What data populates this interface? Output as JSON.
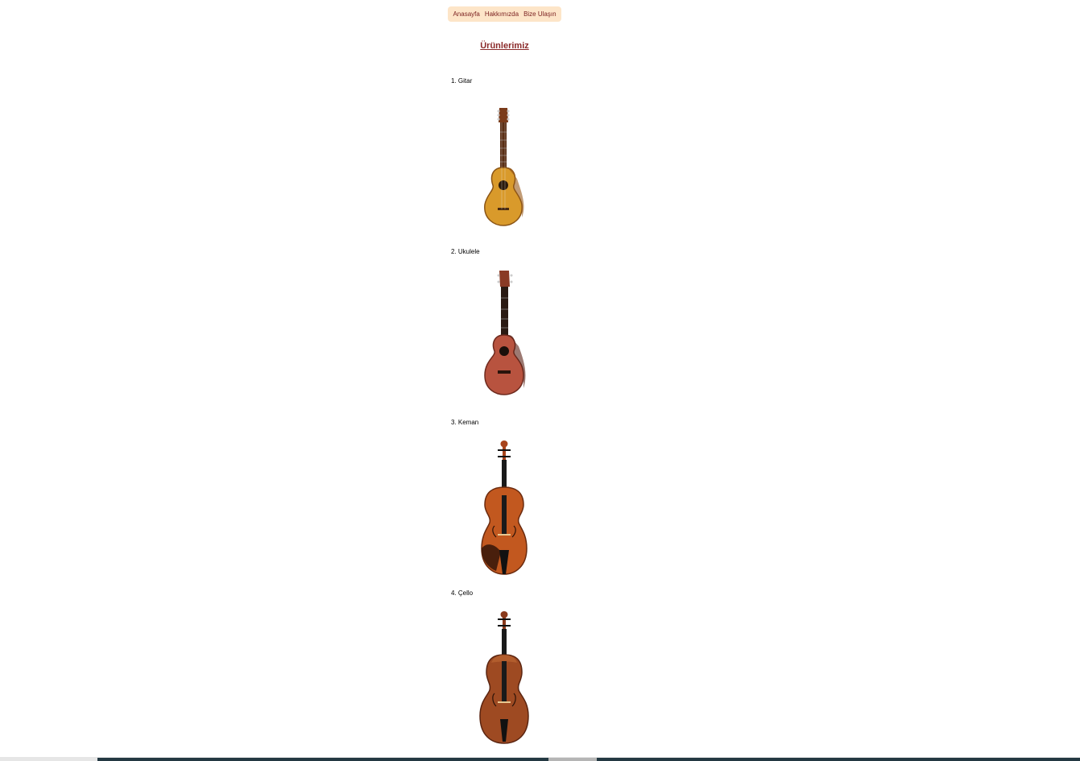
{
  "nav": {
    "home": "Anasayfa",
    "about": "Hakkımızda",
    "contact": "Bize Ulaşın"
  },
  "page": {
    "title": "Ürünlerimiz"
  },
  "products": [
    {
      "label": "1. Gitar",
      "icon": "guitar-image"
    },
    {
      "label": "2. Ukulele",
      "icon": "ukulele-image"
    },
    {
      "label": "3. Keman",
      "icon": "violin-image"
    },
    {
      "label": "4. Çello",
      "icon": "cello-image"
    }
  ],
  "colors": {
    "nav_bg": "#fde5c8",
    "link": "#7a1f1f",
    "title": "#8b2a2a"
  }
}
